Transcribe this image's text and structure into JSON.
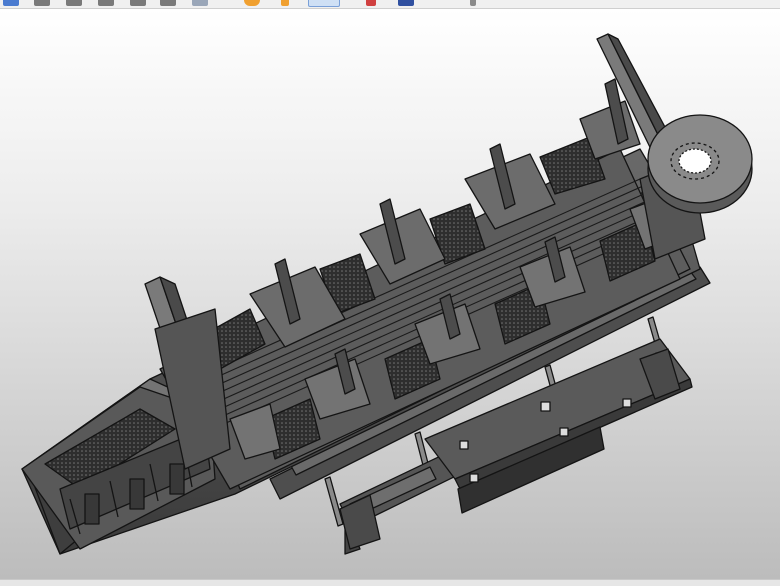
{
  "toolbar": {
    "buttons": [
      {
        "icon": "select-icon",
        "color": "#4a7bd0"
      },
      {
        "icon": "pan-icon",
        "color": "#7a7a7a"
      },
      {
        "icon": "zoom-icon",
        "color": "#7a7a7a"
      },
      {
        "icon": "rotate-icon",
        "color": "#7a7a7a"
      },
      {
        "icon": "fit-view-icon",
        "color": "#7a7a7a"
      },
      {
        "icon": "section-icon",
        "color": "#7a7a7a"
      },
      {
        "icon": "ruler-icon",
        "color": "#9aa6b8"
      },
      {
        "icon": "sun-icon",
        "color": "#f0a030"
      },
      {
        "icon": "pin-icon",
        "color": "#f0a030"
      },
      {
        "icon": "shading-icon",
        "color": "#5aa05a"
      },
      {
        "icon": "paint-icon",
        "color": "#d04040"
      },
      {
        "icon": "save-view-icon",
        "color": "#3050a0"
      },
      {
        "icon": "pointer-icon",
        "color": "#8a8a8a"
      }
    ]
  },
  "colors": {
    "model_dark": "#3f3f3f",
    "model_mid": "#5e5e5e",
    "model_light": "#7a7a7a",
    "outline": "#141414"
  }
}
